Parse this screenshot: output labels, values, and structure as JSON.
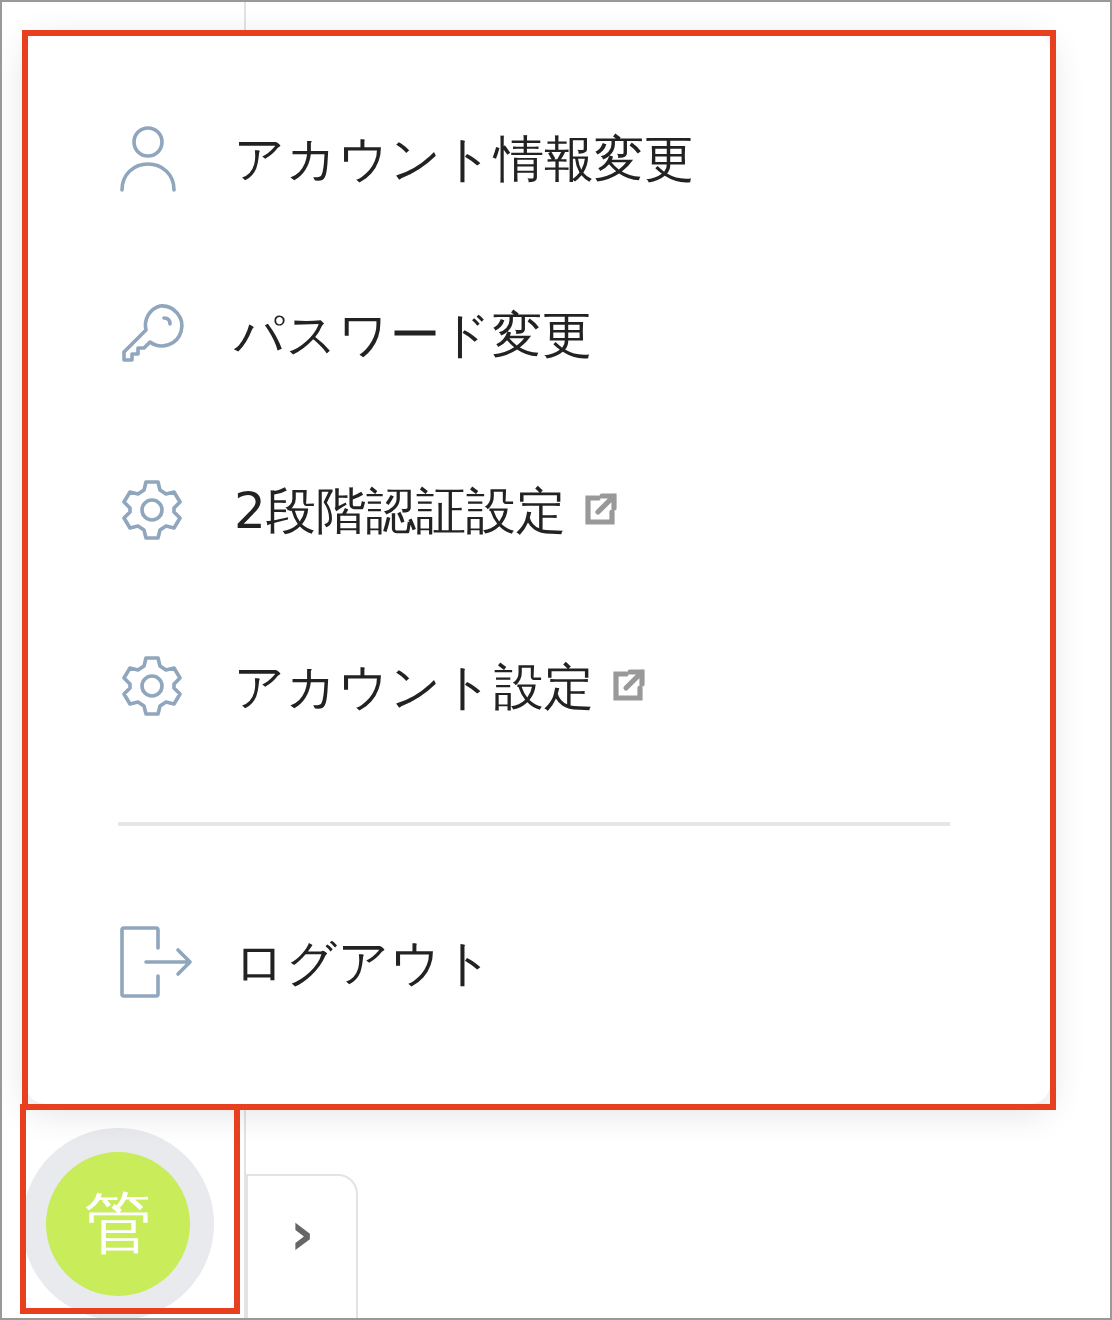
{
  "menu": {
    "items": [
      {
        "label": "アカウント情報変更",
        "kind": "person",
        "external": false
      },
      {
        "label": "パスワード変更",
        "kind": "key",
        "external": false
      },
      {
        "label": "2段階認証設定",
        "kind": "gear",
        "external": true
      },
      {
        "label": "アカウント設定",
        "kind": "gear",
        "external": true
      }
    ],
    "footer_items": [
      {
        "label": "ログアウト",
        "kind": "logout",
        "external": false
      }
    ]
  },
  "avatar": {
    "initial": "管"
  },
  "sidebar_toggle": {
    "symbol": "›"
  }
}
